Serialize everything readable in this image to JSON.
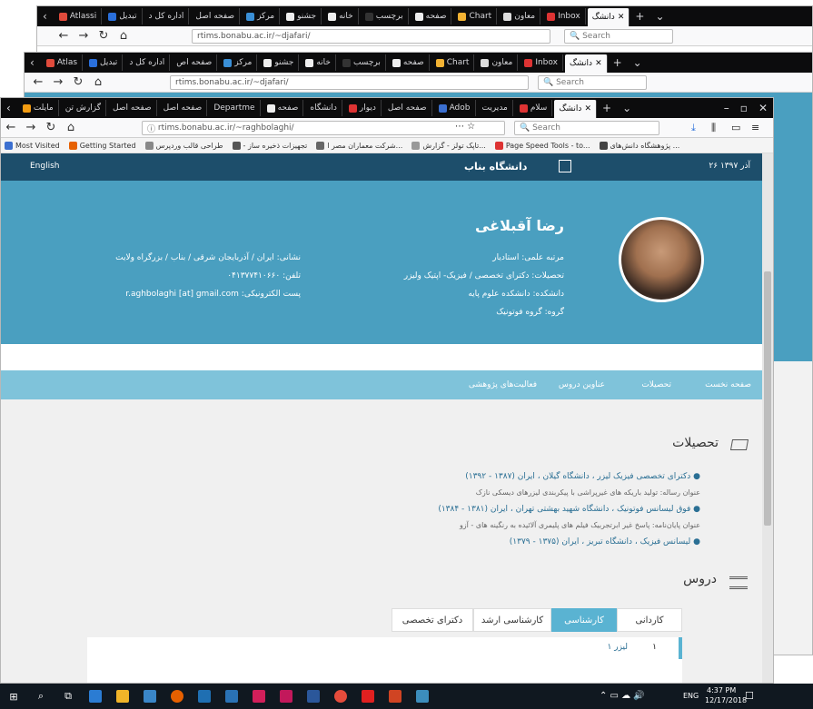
{
  "back_window_1": {
    "tabs": [
      "Atlassi",
      "تبدیل",
      "اداره کل د",
      "صفحه اصل",
      "مرکز",
      "جشنو",
      "خانه",
      "برچسب",
      "صفحه",
      "Chart",
      "معاون",
      "Inbox",
      "دانشگ"
    ],
    "url": "rtims.bonabu.ac.ir/~djafari/",
    "search_placeholder": "Search"
  },
  "back_window_2": {
    "tabs": [
      "Atlas",
      "تبدیل",
      "اداره کل د",
      "صفحه اص",
      "مرکز",
      "جشنو",
      "خانه",
      "برچسب",
      "صفحه",
      "Chart",
      "معاون",
      "Inbox",
      "دانشگ"
    ],
    "url": "rtims.bonabu.ac.ir/~djafari/",
    "search_placeholder": "Search"
  },
  "front_window": {
    "tabs": [
      "مایلت",
      "گزارش تن",
      "صفحه اصل",
      "صفحه اصل",
      "Departme",
      "صفحه",
      "دانشگاه",
      "دیوار",
      "صفحه اصل",
      "Adob",
      "مدیریت",
      "سلام",
      "دانشگ"
    ],
    "url": "rtims.bonabu.ac.ir/~raghbolaghi/",
    "search_placeholder": "Search",
    "bookmarks": [
      "Most Visited",
      "Getting Started",
      "طراحی قالب وردپرس",
      "- تجهیزات ذخیره ساز",
      "شرکت معماران مصر ا...",
      "تاپک تولز - گزارش...",
      "Page Speed Tools - to...",
      "پژوهشگاه دانش‌های ..."
    ]
  },
  "site": {
    "date": "۲۶ آذر ۱۳۹۷",
    "university": "دانشگاه بناب",
    "language": "English",
    "name": "رضا آقبلاغی",
    "rank_label": "مرتبه علمی:",
    "rank_value": "استادیار",
    "education_label": "تحصیلات:",
    "education_value": "دکترای تخصصی / فیزیک- اپتیک ولیزر",
    "faculty_label": "دانشکده:",
    "faculty_value": "دانشکده علوم پایه",
    "group_label": "گروه:",
    "group_value": "گروه فوتونیک",
    "address_label": "نشانی:",
    "address_value": "ایران / آذربایجان شرقی / بناب / بزرگراه ولایت",
    "phone_label": "تلفن:",
    "phone_value": "۰۴۱۳۷۷۴۱۰۶۶۰",
    "email_label": "پست الکترونیکی:",
    "email_value": "r.aghbolaghi [at] gmail.com",
    "nav": [
      "صفحه نخست",
      "تحصیلات",
      "عناوین دروس",
      "فعالیت‌های پژوهشی"
    ],
    "education_heading": "تحصیلات",
    "education_items": [
      {
        "title": "دکترای تخصصی فیزیک لیزر ، دانشگاه گیلان ، ایران (۱۳۸۷ - ۱۳۹۲)",
        "thesis": "عنوان رساله: تولید باریکه های غیرپراشی با پیکربندی لیزرهای دیسکی نازک"
      },
      {
        "title": "فوق لیسانس فوتونیک ، دانشگاه شهید بهشتی تهران ، ایران (۱۳۸۱ - ۱۳۸۴)",
        "thesis": "عنوان پایان‌نامه: پاسخ غیر ابرتجربیک فیلم های پلیمری آلائیده به رنگینه های - آزو"
      },
      {
        "title": "لیسانس فیزیک ، دانشگاه تبریز ، ایران (۱۳۷۵ - ۱۳۷۹)",
        "thesis": ""
      }
    ],
    "courses_heading": "دروس",
    "course_tabs": [
      "کاردانی",
      "کارشناسی",
      "کارشناسی ارشد",
      "دکترای تخصصی"
    ],
    "course_row_num": "۱",
    "course_row_text": "لیزر ۱"
  },
  "taskbar": {
    "time": "4:37 PM",
    "date": "12/17/2018",
    "lang": "ENG"
  },
  "colors": {
    "header": "#1d4e6b",
    "profile": "#4a9fc0",
    "subnav": "#7fc3da",
    "accent": "#5ab3d2"
  }
}
